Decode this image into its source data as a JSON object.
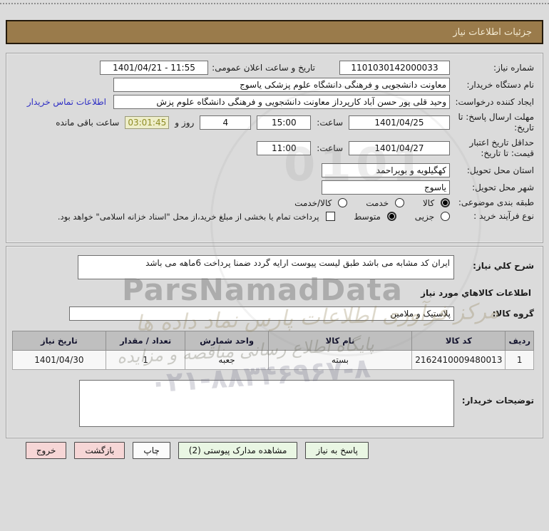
{
  "header": {
    "title": "جزئیات اطلاعات نیاز"
  },
  "form": {
    "need_number": {
      "label": "شماره نیاز:",
      "value": "1101030142000033"
    },
    "announce_datetime": {
      "label": "تاریخ و ساعت اعلان عمومی:",
      "value": "1401/04/21 - 11:55"
    },
    "buyer_org": {
      "label": "نام دستگاه خریدار:",
      "value": "معاونت دانشجویی و فرهنگی دانشگاه علوم پزشکی یاسوج"
    },
    "request_creator": {
      "label": "ایجاد کننده درخواست:",
      "value": "وحید قلی پور حسن آباد کارپرداز معاونت دانشجویی و فرهنگی دانشگاه علوم پزش",
      "contact_link": "اطلاعات تماس خریدار"
    },
    "response_deadline": {
      "label": "مهلت ارسال پاسخ: تا تاریخ:",
      "date": "1401/04/25",
      "hour_label": "ساعت:",
      "time": "15:00",
      "days_value": "4",
      "days_suffix": "روز و",
      "countdown": "03:01:45",
      "countdown_suffix": "ساعت باقی مانده"
    },
    "price_validity": {
      "label": "حداقل تاریخ اعتبار قیمت: تا تاریخ:",
      "date": "1401/04/27",
      "hour_label": "ساعت:",
      "time": "11:00"
    },
    "delivery_province": {
      "label": "استان محل تحویل:",
      "value": "کهگیلویه و بویراحمد"
    },
    "delivery_city": {
      "label": "شهر محل تحویل:",
      "value": "یاسوج"
    },
    "subject_class": {
      "label": "طبقه بندی موضوعی:",
      "options": [
        {
          "label": "کالا",
          "selected": true
        },
        {
          "label": "خدمت",
          "selected": false
        },
        {
          "label": "کالا/خدمت",
          "selected": false
        }
      ]
    },
    "process_type": {
      "label": "نوع فرآیند خرید :",
      "options": [
        {
          "label": "جزیی",
          "selected": false
        },
        {
          "label": "متوسط",
          "selected": true
        }
      ],
      "treasury_checkbox": {
        "label": "پرداخت تمام یا بخشی از مبلغ خرید،از محل \"اسناد خزانه اسلامی\" خواهد بود.",
        "checked": false
      }
    }
  },
  "need_desc": {
    "label": "شرح کلي نياز:",
    "value": "ایران کد مشابه می باشد طبق لیست پیوست ارایه گردد ضمنا پرداخت 6ماهه می باشد"
  },
  "goods_section": {
    "heading": "اطلاعات کالاهاي مورد نیاز",
    "group_label": "گروه کالا:",
    "group_value": "پلاستیک و ملامین",
    "table": {
      "headers": [
        "ردیف",
        "کد کالا",
        "نام کالا",
        "واحد شمارش",
        "تعداد / مقدار",
        "تاریخ نیاز"
      ],
      "rows": [
        {
          "row": "1",
          "code": "2162410009480013",
          "name": "بسته",
          "unit": "جعبه",
          "qty": "1",
          "date": "1401/04/30"
        }
      ]
    }
  },
  "buyer_notes": {
    "label": "توضیحات خریدار:",
    "value": ""
  },
  "buttons": {
    "reply": "پاسخ به نیاز",
    "view_docs": "مشاهده مدارک پیوستی (2)",
    "print": "چاپ",
    "back": "بازگشت",
    "exit": "خروج"
  },
  "watermark": {
    "brand": "ParsNamadData",
    "digits": "0101",
    "line1": "مرکز فرآوری اطلاعات پارس نماد داده ها",
    "line2": "پایگاه اطلاع رسانی مناقصه و مزایده",
    "phone": "۰۲۱-۸۸۳۴۶۹۶۷-۸"
  }
}
